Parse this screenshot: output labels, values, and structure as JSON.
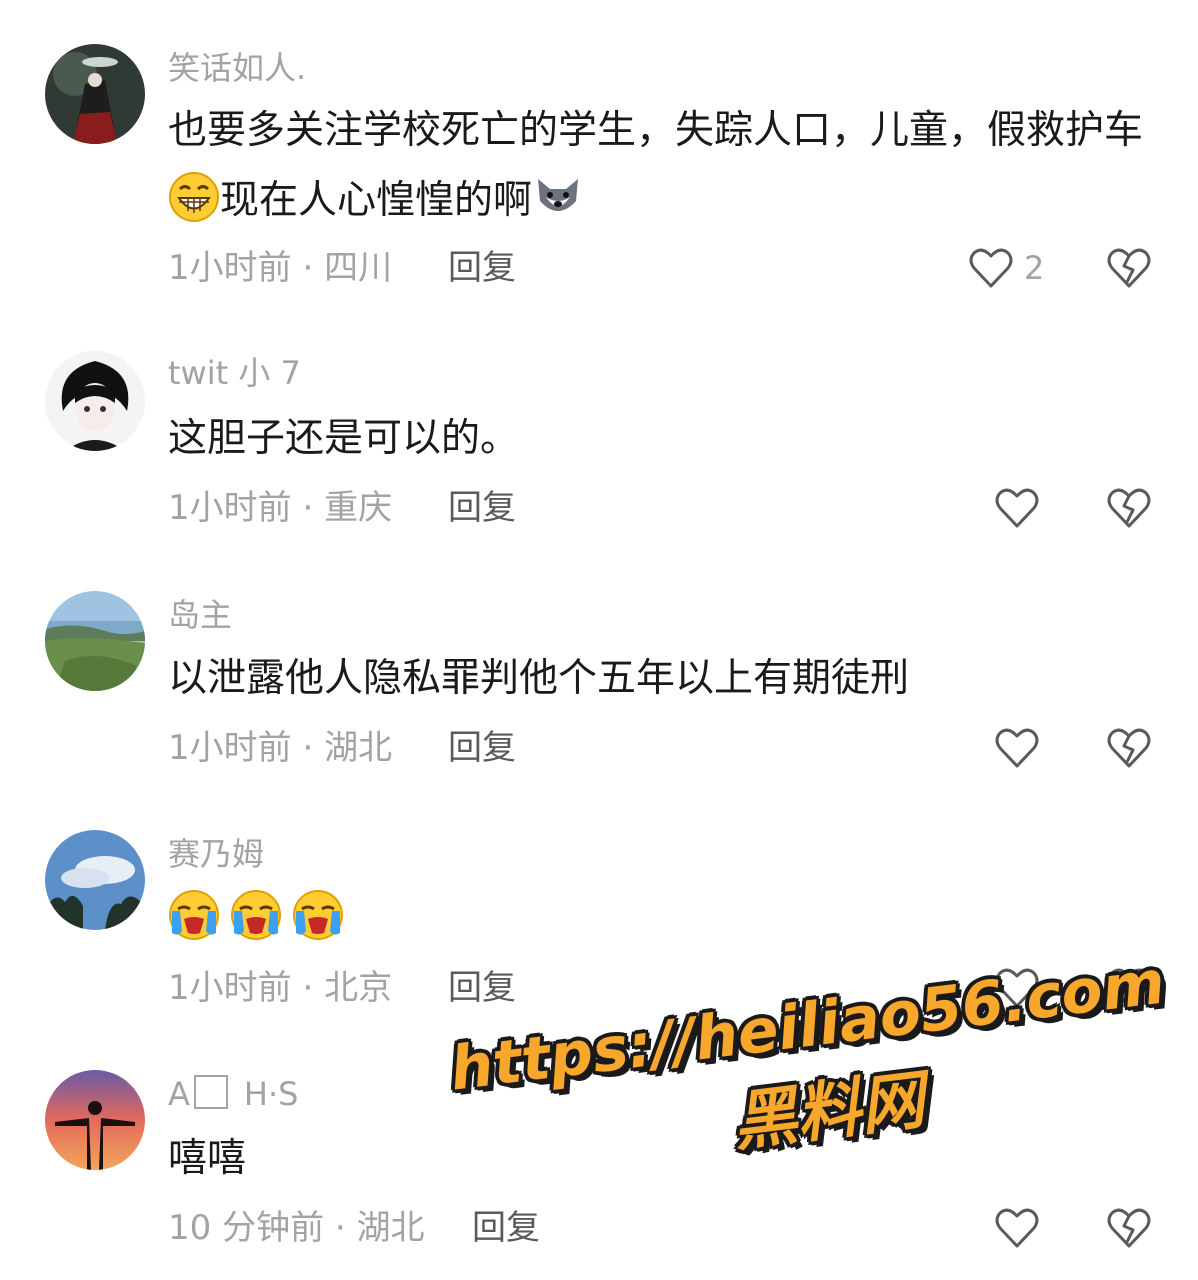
{
  "comments": [
    {
      "username": "笑话如人.",
      "text_before": "也要多关注学校死亡的学生，失踪人口，儿童，假救护车",
      "emoji_1": "grinning-face",
      "text_middle": "现在人心惶惶的啊",
      "emoji_2": "wolf-face",
      "time": "1小时前",
      "location": "四川",
      "reply": "回复",
      "like_count": "2"
    },
    {
      "username": "twit 小 7",
      "text": "这胆子还是可以的。",
      "time": "1小时前",
      "location": "重庆",
      "reply": "回复"
    },
    {
      "username": "岛主",
      "text": "以泄露他人隐私罪判他个五年以上有期徒刑",
      "time": "1小时前",
      "location": "湖北",
      "reply": "回复"
    },
    {
      "username": "赛乃姆",
      "emojis": [
        "loudly-crying-face",
        "loudly-crying-face",
        "loudly-crying-face"
      ],
      "time": "1小时前",
      "location": "北京",
      "reply": "回复"
    },
    {
      "username_a": "A",
      "username_b": "H·S",
      "text": "嘻嘻",
      "time": "10 分钟前",
      "location": "湖北",
      "reply": "回复"
    }
  ],
  "separator": "·",
  "watermark": {
    "url": "https://heiliao56.com",
    "name": "黑料网"
  },
  "icons": {
    "like": "heart-outline-icon",
    "dislike": "broken-heart-icon"
  },
  "colors": {
    "text": "#1a1a1a",
    "muted": "#a3a3a6",
    "reply": "#5a5a5e",
    "watermark": "#f7a72b"
  }
}
